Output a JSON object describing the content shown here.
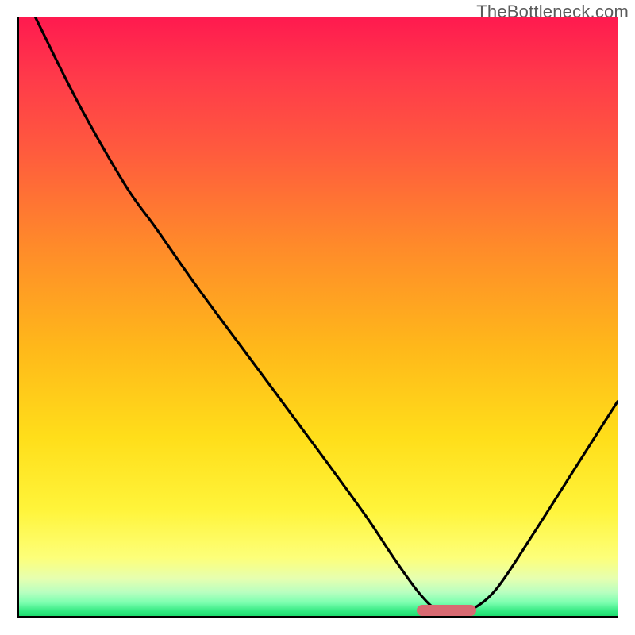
{
  "watermark": "TheBottleneck.com",
  "chart_data": {
    "type": "line",
    "title": "",
    "xlabel": "",
    "ylabel": "",
    "xlim": [
      0,
      100
    ],
    "ylim": [
      0,
      100
    ],
    "gradient_stops": [
      {
        "offset": 0.0,
        "color": "#ff1a4f"
      },
      {
        "offset": 0.1,
        "color": "#ff3a4a"
      },
      {
        "offset": 0.22,
        "color": "#ff5a3e"
      },
      {
        "offset": 0.38,
        "color": "#ff8a2a"
      },
      {
        "offset": 0.55,
        "color": "#ffb81a"
      },
      {
        "offset": 0.7,
        "color": "#ffde1a"
      },
      {
        "offset": 0.82,
        "color": "#fff43a"
      },
      {
        "offset": 0.9,
        "color": "#fdff79"
      },
      {
        "offset": 0.935,
        "color": "#e6ffb0"
      },
      {
        "offset": 0.958,
        "color": "#b8ffc0"
      },
      {
        "offset": 0.975,
        "color": "#7dffb0"
      },
      {
        "offset": 0.99,
        "color": "#30e880"
      },
      {
        "offset": 1.0,
        "color": "#18d868"
      }
    ],
    "curve_points": [
      {
        "x": 3.0,
        "y": 100.0
      },
      {
        "x": 10.0,
        "y": 86.0
      },
      {
        "x": 18.0,
        "y": 72.0
      },
      {
        "x": 23.0,
        "y": 65.0
      },
      {
        "x": 30.0,
        "y": 55.0
      },
      {
        "x": 40.0,
        "y": 41.5
      },
      {
        "x": 50.0,
        "y": 28.0
      },
      {
        "x": 58.0,
        "y": 17.0
      },
      {
        "x": 63.0,
        "y": 9.5
      },
      {
        "x": 67.0,
        "y": 4.0
      },
      {
        "x": 70.0,
        "y": 1.2
      },
      {
        "x": 73.0,
        "y": 0.6
      },
      {
        "x": 76.0,
        "y": 1.5
      },
      {
        "x": 80.0,
        "y": 5.0
      },
      {
        "x": 86.0,
        "y": 14.0
      },
      {
        "x": 93.0,
        "y": 25.0
      },
      {
        "x": 100.0,
        "y": 36.0
      }
    ],
    "marker": {
      "x_start": 66.5,
      "x_end": 76.5,
      "color": "#d86a72"
    }
  }
}
